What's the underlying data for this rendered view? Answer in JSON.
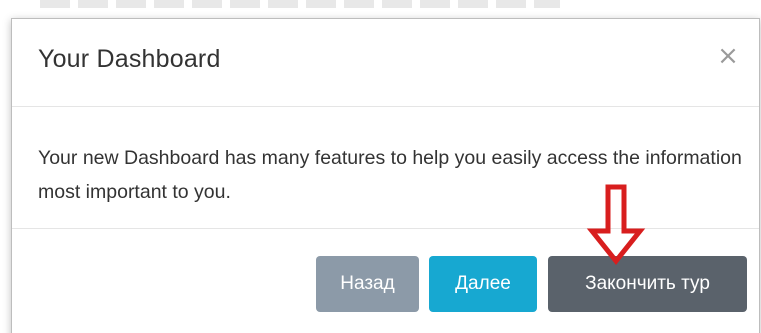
{
  "modal": {
    "title": "Your Dashboard",
    "close_symbol": "×",
    "body_text": "Your new Dashboard has many features to help you easily access the information most important to you."
  },
  "footer": {
    "back_label": "Назад",
    "next_label": "Далее",
    "end_tour_label": "Закончить тур"
  },
  "annotation": {
    "icon": "down-arrow-icon",
    "color": "#d81e1e"
  },
  "colors": {
    "back_button": "#8c9aa8",
    "next_button": "#17a8d1",
    "end_button": "#5a626b"
  }
}
